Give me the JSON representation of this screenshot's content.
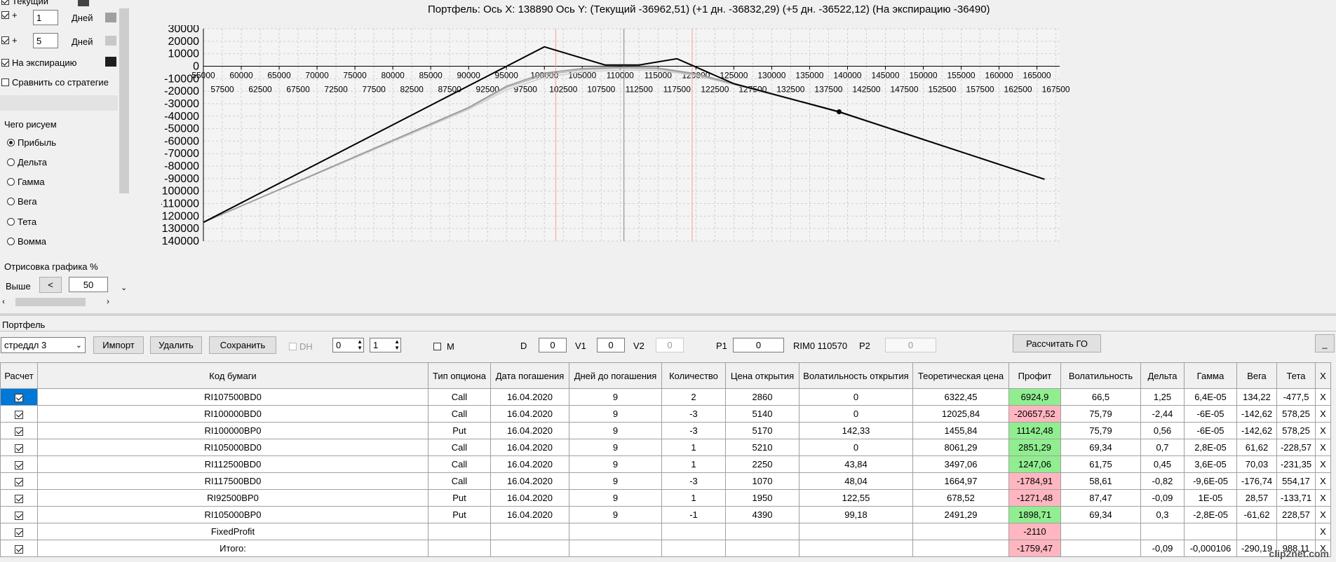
{
  "left_panel": {
    "row_current_label": "Текущий",
    "row1_plus": "+",
    "row1_days_value": "1",
    "row1_days_label": "Дней",
    "row2_plus": "+",
    "row2_days_value": "5",
    "row2_days_label": "Дней",
    "expiration_label": "На экспирацию",
    "compare_label": "Сравнить со стратегие",
    "what_draw_label": "Чего рисуем",
    "radios": [
      "Прибыль",
      "Дельта",
      "Гамма",
      "Вега",
      "Тета",
      "Вомма"
    ],
    "selected_radio": "Прибыль",
    "render_label": "Отрисовка графика %",
    "above_label": "Выше",
    "less_button": "<",
    "percent_value": "50",
    "swatch_colors": [
      "#444444",
      "#a0a0a0",
      "#c8c8c8",
      "#1e1e1e"
    ]
  },
  "chart": {
    "title": "Портфель: Ось X: 138890 Ось Y:  (Текущий -36962,51)  (+1 дн. -36832,29)  (+5 дн. -36522,12)  (На экспирацию -36490)"
  },
  "chart_data": {
    "type": "line",
    "title": "Портфель: Ось X: 138890 Ось Y:  (Текущий -36962,51)  (+1 дн. -36832,29)  (+5 дн. -36522,12)  (На экспирацию -36490)",
    "xlabel": "",
    "ylabel": "",
    "xlim": [
      55000,
      168000
    ],
    "ylim": [
      -140000,
      30000
    ],
    "x_ticks_top": [
      55000,
      60000,
      65000,
      70000,
      75000,
      80000,
      85000,
      90000,
      95000,
      100000,
      105000,
      110000,
      115000,
      120000,
      125000,
      130000,
      135000,
      140000,
      145000,
      150000,
      155000,
      160000,
      165000
    ],
    "x_ticks_bottom": [
      57500,
      62500,
      67500,
      72500,
      77500,
      82500,
      87500,
      92500,
      97500,
      102500,
      107500,
      112500,
      117500,
      122500,
      127500,
      132500,
      137500,
      142500,
      147500,
      152500,
      157500,
      162500,
      167500
    ],
    "y_ticks": [
      30000,
      20000,
      10000,
      0,
      -10000,
      -20000,
      -30000,
      -40000,
      -50000,
      -60000,
      -70000,
      -80000,
      -90000,
      -100000,
      -110000,
      -120000,
      -130000,
      -140000
    ],
    "grid": true,
    "vertical_lines": [
      {
        "x": 101500,
        "color": "#ff9999"
      },
      {
        "x": 110500,
        "color": "#808080"
      },
      {
        "x": 119500,
        "color": "#ff9999"
      }
    ],
    "marker": {
      "x": 138890,
      "y": -36490
    },
    "series": [
      {
        "color": "#000000",
        "x": [
          55000,
          100000,
          108000,
          112500,
          117500,
          125000,
          138890,
          166000
        ],
        "y": [
          -125000,
          15500,
          1000,
          1000,
          6000,
          -14000,
          -36490,
          -90500
        ]
      },
      {
        "color": "#9a9a9a",
        "x": [
          55000,
          90000,
          95000,
          100000,
          105000,
          110000,
          115000,
          120000,
          125000,
          130000,
          138890,
          166000
        ],
        "y": [
          -125000,
          -33000,
          -16000,
          -5500,
          -1800,
          -800,
          -1500,
          -6000,
          -14000,
          -22000,
          -36962,
          -90500
        ]
      },
      {
        "color": "#b4b4b4",
        "x": [
          55000,
          90000,
          95000,
          100000,
          105000,
          110000,
          115000,
          120000,
          125000,
          130000,
          138890,
          166000
        ],
        "y": [
          -125000,
          -33500,
          -17000,
          -7000,
          -2800,
          -1500,
          -2000,
          -6800,
          -14200,
          -22300,
          -36832,
          -90500
        ]
      },
      {
        "color": "#cfcfcf",
        "x": [
          55000,
          90000,
          95000,
          100000,
          105000,
          110000,
          115000,
          120000,
          125000,
          130000,
          138890,
          166000
        ],
        "y": [
          -125000,
          -34500,
          -19000,
          -9000,
          -4500,
          -3000,
          -3300,
          -7500,
          -14800,
          -22600,
          -36522,
          -90500
        ]
      }
    ]
  },
  "portfolio": {
    "section_label": "Портфель",
    "strategy_value": "стреддл 3",
    "import_button": "Импорт",
    "delete_button": "Удалить",
    "save_button": "Сохранить",
    "dh_label": "DH",
    "spin1_value": "0",
    "spin2_value": "1",
    "m_label": "M",
    "d_label": "D",
    "d_value": "0",
    "v1_label": "V1",
    "v1_value": "0",
    "v2_label": "V2",
    "v2_value": "0",
    "p1_label": "P1",
    "p1_value": "0",
    "rim_label": "RIM0 110570",
    "p2_label": "P2",
    "p2_value": "0",
    "calc_button": "Рассчитать ГО",
    "minimize_button": "_"
  },
  "table": {
    "headers": [
      "Расчет",
      "Код бумаги",
      "Тип опциона",
      "Дата погашения",
      "Дней до погашения",
      "Количество",
      "Цена открытия",
      "Волатильность открытия",
      "Теоретическая цена",
      "Профит",
      "Волатильность",
      "Дельта",
      "Гамма",
      "Вега",
      "Тета",
      "X"
    ],
    "rows": [
      {
        "code": "RI107500BD0",
        "type": "Call",
        "date": "16.04.2020",
        "days": "9",
        "qty": "2",
        "price": "2860",
        "vol_open": "0",
        "theo": "6322,45",
        "profit": "6924,9",
        "profit_state": "g",
        "vol": "66,5",
        "delta": "1,25",
        "gamma": "6,4E-05",
        "vega": "134,22",
        "theta": "-477,5",
        "x": "X",
        "selected": true
      },
      {
        "code": "RI100000BD0",
        "type": "Call",
        "date": "16.04.2020",
        "days": "9",
        "qty": "-3",
        "price": "5140",
        "vol_open": "0",
        "theo": "12025,84",
        "profit": "-20657,52",
        "profit_state": "r",
        "vol": "75,79",
        "delta": "-2,44",
        "gamma": "-6E-05",
        "vega": "-142,62",
        "theta": "578,25",
        "x": "X",
        "selected": false
      },
      {
        "code": "RI100000BP0",
        "type": "Put",
        "date": "16.04.2020",
        "days": "9",
        "qty": "-3",
        "price": "5170",
        "vol_open": "142,33",
        "theo": "1455,84",
        "profit": "11142,48",
        "profit_state": "g",
        "vol": "75,79",
        "delta": "0,56",
        "gamma": "-6E-05",
        "vega": "-142,62",
        "theta": "578,25",
        "x": "X",
        "selected": false
      },
      {
        "code": "RI105000BD0",
        "type": "Call",
        "date": "16.04.2020",
        "days": "9",
        "qty": "1",
        "price": "5210",
        "vol_open": "0",
        "theo": "8061,29",
        "profit": "2851,29",
        "profit_state": "g",
        "vol": "69,34",
        "delta": "0,7",
        "gamma": "2,8E-05",
        "vega": "61,62",
        "theta": "-228,57",
        "x": "X",
        "selected": false
      },
      {
        "code": "RI112500BD0",
        "type": "Call",
        "date": "16.04.2020",
        "days": "9",
        "qty": "1",
        "price": "2250",
        "vol_open": "43,84",
        "theo": "3497,06",
        "profit": "1247,06",
        "profit_state": "g",
        "vol": "61,75",
        "delta": "0,45",
        "gamma": "3,6E-05",
        "vega": "70,03",
        "theta": "-231,35",
        "x": "X",
        "selected": false
      },
      {
        "code": "RI117500BD0",
        "type": "Call",
        "date": "16.04.2020",
        "days": "9",
        "qty": "-3",
        "price": "1070",
        "vol_open": "48,04",
        "theo": "1664,97",
        "profit": "-1784,91",
        "profit_state": "r",
        "vol": "58,61",
        "delta": "-0,82",
        "gamma": "-9,6E-05",
        "vega": "-176,74",
        "theta": "554,17",
        "x": "X",
        "selected": false
      },
      {
        "code": "RI92500BP0",
        "type": "Put",
        "date": "16.04.2020",
        "days": "9",
        "qty": "1",
        "price": "1950",
        "vol_open": "122,55",
        "theo": "678,52",
        "profit": "-1271,48",
        "profit_state": "r",
        "vol": "87,47",
        "delta": "-0,09",
        "gamma": "1E-05",
        "vega": "28,57",
        "theta": "-133,71",
        "x": "X",
        "selected": false
      },
      {
        "code": "RI105000BP0",
        "type": "Put",
        "date": "16.04.2020",
        "days": "9",
        "qty": "-1",
        "price": "4390",
        "vol_open": "99,18",
        "theo": "2491,29",
        "profit": "1898,71",
        "profit_state": "g",
        "vol": "69,34",
        "delta": "0,3",
        "gamma": "-2,8E-05",
        "vega": "-61,62",
        "theta": "228,57",
        "x": "X",
        "selected": false
      },
      {
        "code": "FixedProfit",
        "type": "",
        "date": "",
        "days": "",
        "qty": "",
        "price": "",
        "vol_open": "",
        "theo": "",
        "profit": "-2110",
        "profit_state": "r",
        "vol": "",
        "delta": "",
        "gamma": "",
        "vega": "",
        "theta": "",
        "x": "X",
        "selected": false
      },
      {
        "code": "Итого:",
        "type": "",
        "date": "",
        "days": "",
        "qty": "",
        "price": "",
        "vol_open": "",
        "theo": "",
        "profit": "-1759,47",
        "profit_state": "r",
        "vol": "",
        "delta": "-0,09",
        "gamma": "-0,000106",
        "vega": "-290,19",
        "theta": "988,11",
        "x": "X",
        "selected": false
      }
    ]
  },
  "watermark": "clip2net.com"
}
